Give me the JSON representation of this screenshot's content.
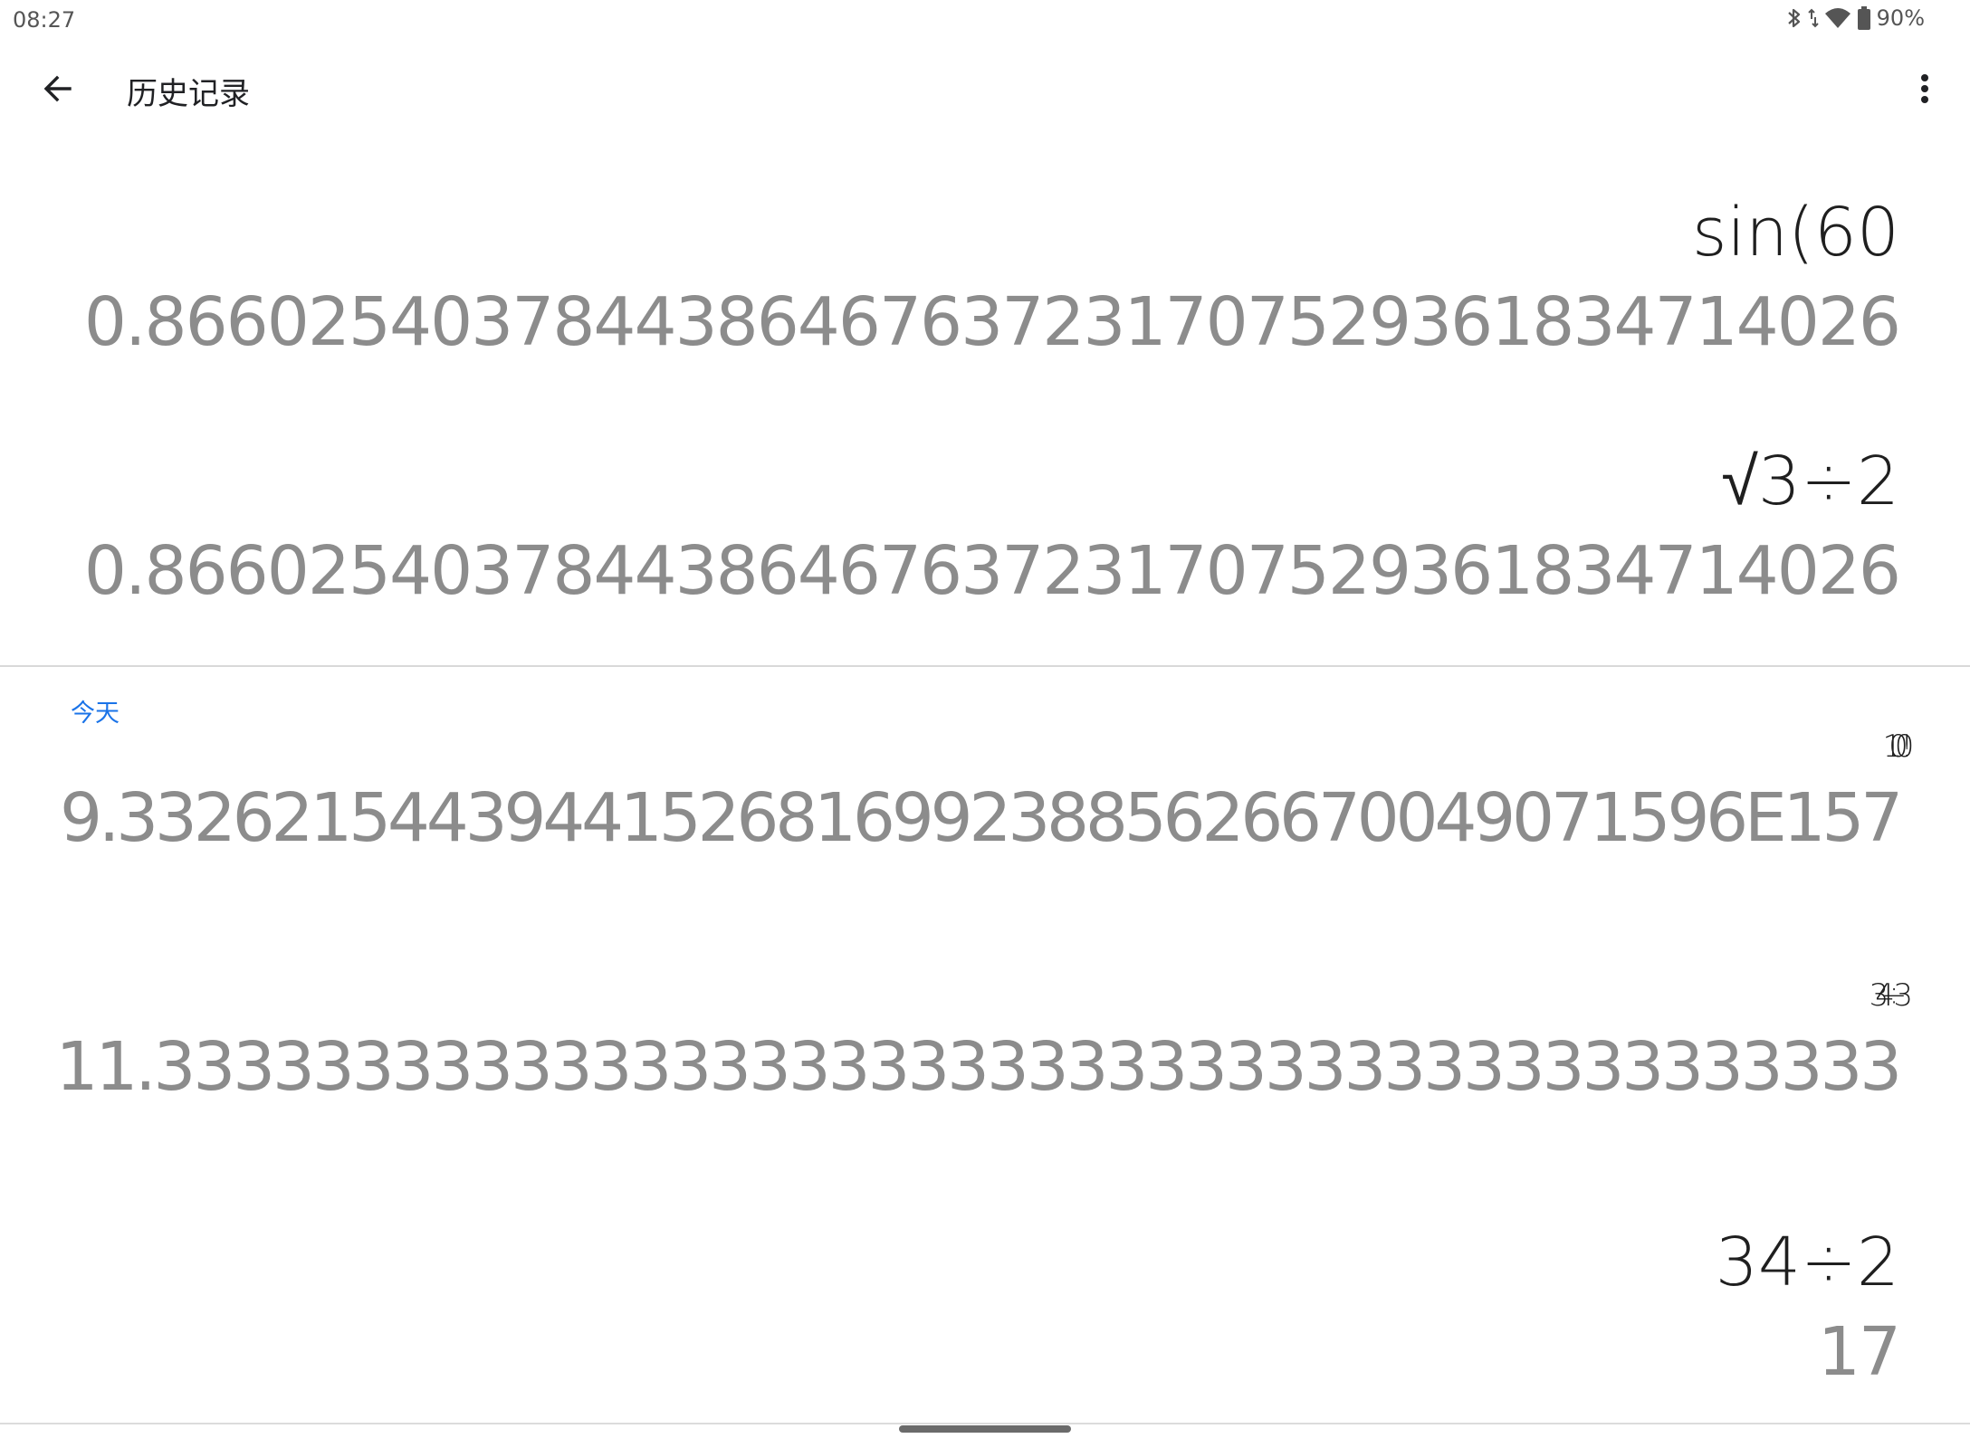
{
  "status_bar": {
    "time": "08:27",
    "battery": "90%",
    "icons": [
      "bluetooth-icon",
      "data-arrows-icon",
      "wifi-icon",
      "battery-icon"
    ]
  },
  "app_bar": {
    "title": "历史记录",
    "back_icon": "arrow-back-icon",
    "menu_icon": "more-vert-icon"
  },
  "history": {
    "older": [
      {
        "expression": "sin(60",
        "result": "0.8660254037844386467637231707529361834714026"
      },
      {
        "expression": "√3÷2",
        "result": "0.8660254037844386467637231707529361834714026"
      }
    ],
    "today_label": "今天",
    "today": [
      {
        "expression": "100!",
        "result": "9.332621544394415268169923885626670049071596E157"
      },
      {
        "expression": "34÷3",
        "result": "11.33333333333333333333333333333333333333333333"
      },
      {
        "expression": "34÷2",
        "result": "17"
      }
    ]
  },
  "colors": {
    "accent": "#1a73e8",
    "expression_text": "#1f1f1f",
    "result_text": "#8c8c8c"
  }
}
